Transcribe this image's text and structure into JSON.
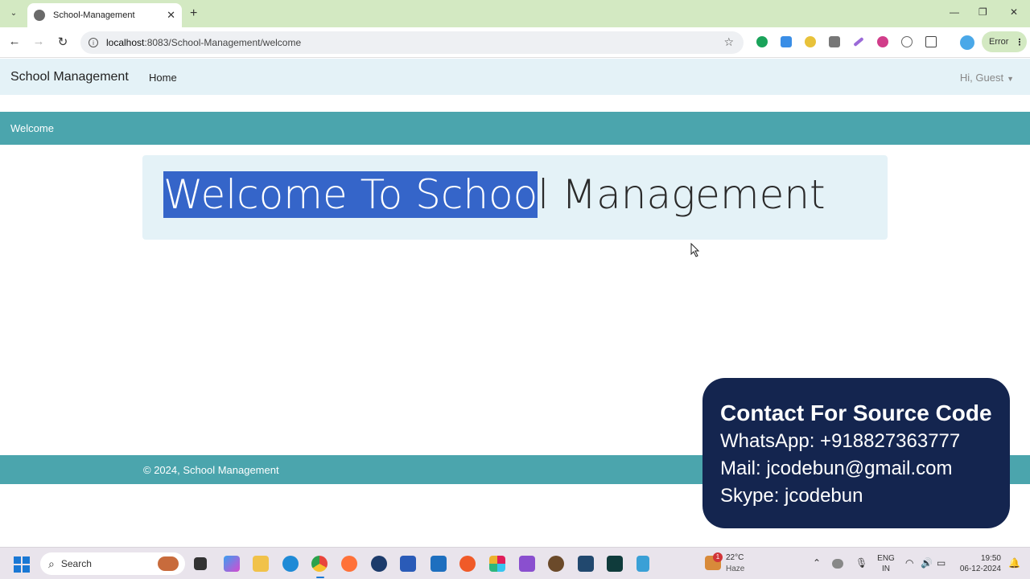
{
  "browser": {
    "tab_title": "School-Management",
    "url_host": "localhost",
    "url_rest": ":8083/School-Management/welcome",
    "error_label": "Error"
  },
  "navbar": {
    "brand": "School Management",
    "home": "Home",
    "user_menu": "Hi, Guest"
  },
  "page": {
    "section_bar": "Welcome",
    "heading_selected": "Welcome To Schoo",
    "heading_rest": "l Management",
    "footer": "© 2024, School Management"
  },
  "contact_card": {
    "title": "Contact For Source Code",
    "whatsapp": "WhatsApp: +918827363777",
    "mail": "Mail: jcodebun@gmail.com",
    "skype": "Skype: jcodebun"
  },
  "taskbar": {
    "search_placeholder": "Search",
    "weather_badge": "1",
    "temperature": "22°C",
    "condition": "Haze",
    "lang_1": "ENG",
    "lang_2": "IN",
    "time": "19:50",
    "date": "06-12-2024"
  },
  "colors": {
    "accent_teal": "#4ba5ad",
    "nav_bg": "#e4f2f7",
    "card_bg": "#14254f",
    "selection": "#3565c9"
  }
}
